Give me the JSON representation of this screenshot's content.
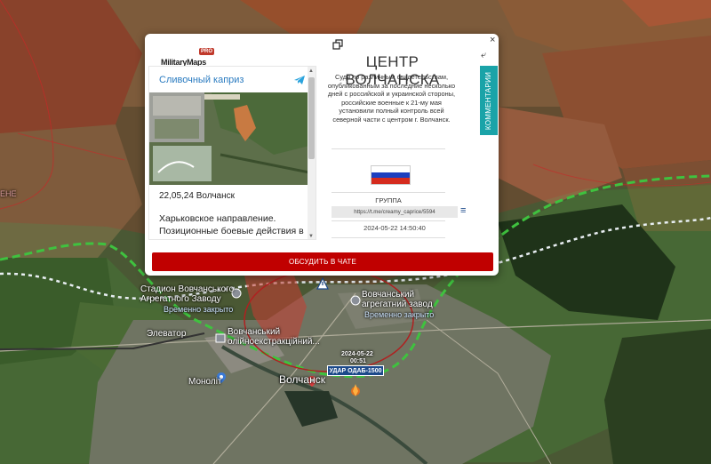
{
  "map": {
    "labels": {
      "stadium": "Стадион Вовчанського\nАгрегатного Заводу",
      "stadium_status": "Временно закрыто",
      "plant": "Вовчанський\nагрегатний завод",
      "plant_status": "Временно закрыто",
      "elevator": "Элеватор",
      "oil_plant": "Вовчанський\nолійноекстракційний...",
      "monolit": "Моноліт",
      "city": "Волчанск",
      "edge_fragment": "ЕНЕ",
      "strike_date": "2024-05-22",
      "strike_time": "00:51",
      "strike_label": "УДАР ОДАБ-1500"
    }
  },
  "popup": {
    "logo_main": "MilitaryMaps",
    "logo_badge": "PRO",
    "close_symbol": "×",
    "title": "ЦЕНТР ВОЛЧАНСКА",
    "description": "Судя по различным свидетельствам, опубликованным за последние несколько дней с российской и украинской стороны, российские военные к 21-му мая установили полный контроль всей северной части с центром г. Волчанск.",
    "flag_colors": [
      "#ffffff",
      "#1c3fbf",
      "#d52b1e"
    ],
    "group_label": "ГРУППА",
    "link": "https://t.me/creamy_caprice/5594",
    "timestamp": "2024-05-22 14:50:40",
    "comments_tab": "КОММЕНТАРИИ",
    "chat_button": "ОБСУДИТЬ В ЧАТЕ",
    "back_symbol": "⤶",
    "menu_symbol": "≡",
    "telegram": {
      "channel": "Сливочный каприз",
      "post_date": "22,05,24 Волчанск",
      "post_text": "Харьковское направление. Позиционные боевые действия в Волчанске."
    }
  }
}
